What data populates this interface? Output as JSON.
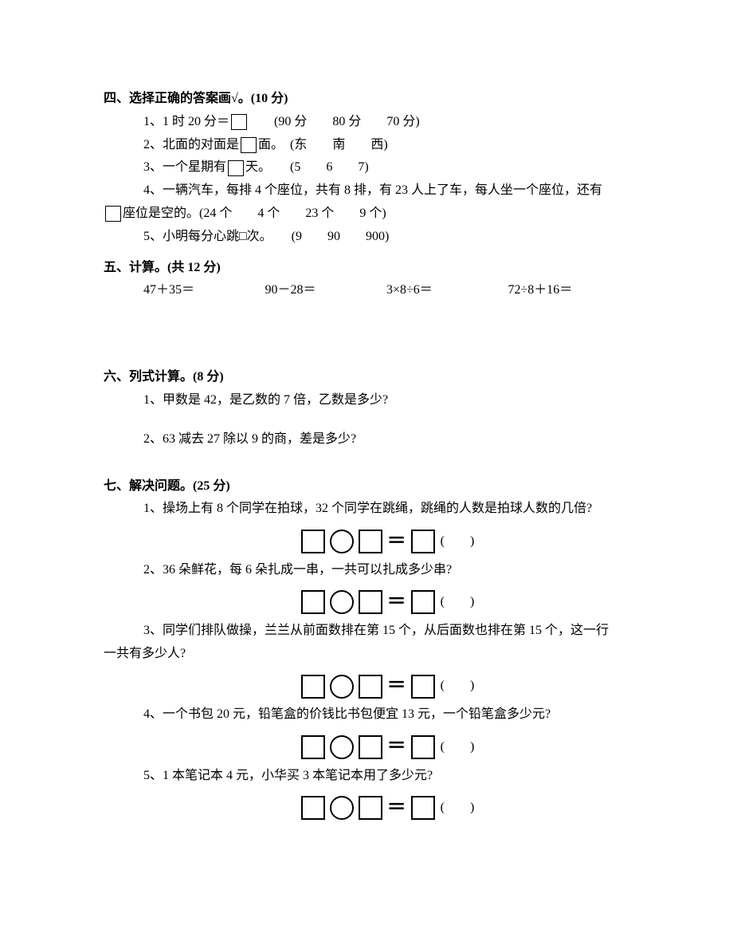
{
  "s4": {
    "title": "四、选择正确的答案画√。(10 分)",
    "q1": {
      "pre": "1、1 时 20 分＝",
      "opts": "(90 分　　80 分　　70 分)"
    },
    "q2": {
      "pre": "2、北面的对面是",
      "post": "面。",
      "opts": "(东　　南　　西)"
    },
    "q3": {
      "pre": "3、一个星期有",
      "post": "天。",
      "opts": "(5　　6　　7)"
    },
    "q4": {
      "line1": "4、一辆汽车，每排 4 个座位，共有 8 排，有 23 人上了车，每人坐一个座位，还有",
      "post": "座位是空的。(24 个　　4 个　　23 个　　9 个)"
    },
    "q5": {
      "text": "5、小明每分心跳□次。　　(9　　90　　900)"
    }
  },
  "s5": {
    "title": "五、计算。(共 12 分)",
    "items": [
      "47＋35＝",
      "90－28＝",
      "3×8÷6＝",
      "72÷8＋16＝"
    ]
  },
  "s6": {
    "title": "六、列式计算。(8 分)",
    "q1": "1、甲数是 42，是乙数的 7 倍，乙数是多少?",
    "q2": "2、63 减去 27 除以 9 的商，差是多少?"
  },
  "s7": {
    "title": "七、解决问题。(25 分)",
    "q1": "1、操场上有 8 个同学在拍球，32 个同学在跳绳，跳绳的人数是拍球人数的几倍?",
    "q2": "2、36 朵鲜花，每 6 朵扎成一串，一共可以扎成多少串?",
    "q3a": "3、同学们排队做操，兰兰从前面数排在第 15 个，从后面数也排在第 15 个，这一行",
    "q3b": "一共有多少人?",
    "q4": "4、一个书包 20 元，铅笔盒的价钱比书包便宜 13 元，一个铅笔盒多少元?",
    "q5": "5、1 本笔记本 4 元，小华买 3 本笔记本用了多少元?",
    "paren": "(　　)"
  }
}
